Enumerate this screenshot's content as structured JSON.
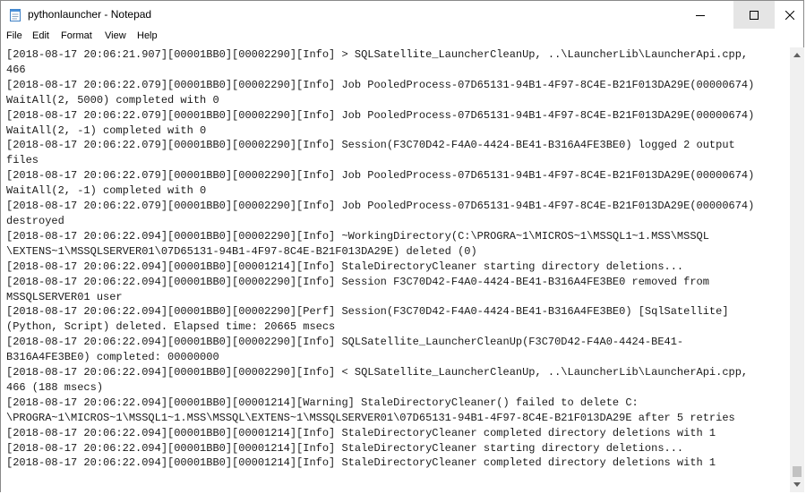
{
  "window": {
    "title": "pythonlauncher - Notepad"
  },
  "menu": [
    "File",
    "Edit",
    "Format",
    "View",
    "Help"
  ],
  "icons": {
    "app": "notepad-icon",
    "minimize": "minimize-icon",
    "maximize": "maximize-icon",
    "close": "close-icon"
  },
  "lines": [
    "[2018-08-17 20:06:21.907][00001BB0][00002290][Info] > SQLSatellite_LauncherCleanUp, ..\\LauncherLib\\LauncherApi.cpp,",
    "466",
    "[2018-08-17 20:06:22.079][00001BB0][00002290][Info] Job PooledProcess-07D65131-94B1-4F97-8C4E-B21F013DA29E(00000674)",
    "WaitAll(2, 5000) completed with 0",
    "[2018-08-17 20:06:22.079][00001BB0][00002290][Info] Job PooledProcess-07D65131-94B1-4F97-8C4E-B21F013DA29E(00000674)",
    "WaitAll(2, -1) completed with 0",
    "[2018-08-17 20:06:22.079][00001BB0][00002290][Info] Session(F3C70D42-F4A0-4424-BE41-B316A4FE3BE0) logged 2 output",
    "files",
    "[2018-08-17 20:06:22.079][00001BB0][00002290][Info] Job PooledProcess-07D65131-94B1-4F97-8C4E-B21F013DA29E(00000674)",
    "WaitAll(2, -1) completed with 0",
    "[2018-08-17 20:06:22.079][00001BB0][00002290][Info] Job PooledProcess-07D65131-94B1-4F97-8C4E-B21F013DA29E(00000674)",
    "destroyed",
    "[2018-08-17 20:06:22.094][00001BB0][00002290][Info] ~WorkingDirectory(C:\\PROGRA~1\\MICROS~1\\MSSQL1~1.MSS\\MSSQL",
    "\\EXTENS~1\\MSSQLSERVER01\\07D65131-94B1-4F97-8C4E-B21F013DA29E) deleted (0)",
    "[2018-08-17 20:06:22.094][00001BB0][00001214][Info] StaleDirectoryCleaner starting directory deletions...",
    "[2018-08-17 20:06:22.094][00001BB0][00002290][Info] Session F3C70D42-F4A0-4424-BE41-B316A4FE3BE0 removed from",
    "MSSQLSERVER01 user",
    "[2018-08-17 20:06:22.094][00001BB0][00002290][Perf] Session(F3C70D42-F4A0-4424-BE41-B316A4FE3BE0) [SqlSatellite]",
    "(Python, Script) deleted. Elapsed time: 20665 msecs",
    "[2018-08-17 20:06:22.094][00001BB0][00002290][Info] SQLSatellite_LauncherCleanUp(F3C70D42-F4A0-4424-BE41-",
    "B316A4FE3BE0) completed: 00000000",
    "[2018-08-17 20:06:22.094][00001BB0][00002290][Info] < SQLSatellite_LauncherCleanUp, ..\\LauncherLib\\LauncherApi.cpp,",
    "466 (188 msecs)",
    "[2018-08-17 20:06:22.094][00001BB0][00001214][Warning] StaleDirectoryCleaner() failed to delete C:",
    "\\PROGRA~1\\MICROS~1\\MSSQL1~1.MSS\\MSSQL\\EXTENS~1\\MSSQLSERVER01\\07D65131-94B1-4F97-8C4E-B21F013DA29E after 5 retries",
    "[2018-08-17 20:06:22.094][00001BB0][00001214][Info] StaleDirectoryCleaner completed directory deletions with 1",
    "[2018-08-17 20:06:22.094][00001BB0][00001214][Info] StaleDirectoryCleaner starting directory deletions...",
    "[2018-08-17 20:06:22.094][00001BB0][00001214][Info] StaleDirectoryCleaner completed directory deletions with 1"
  ]
}
